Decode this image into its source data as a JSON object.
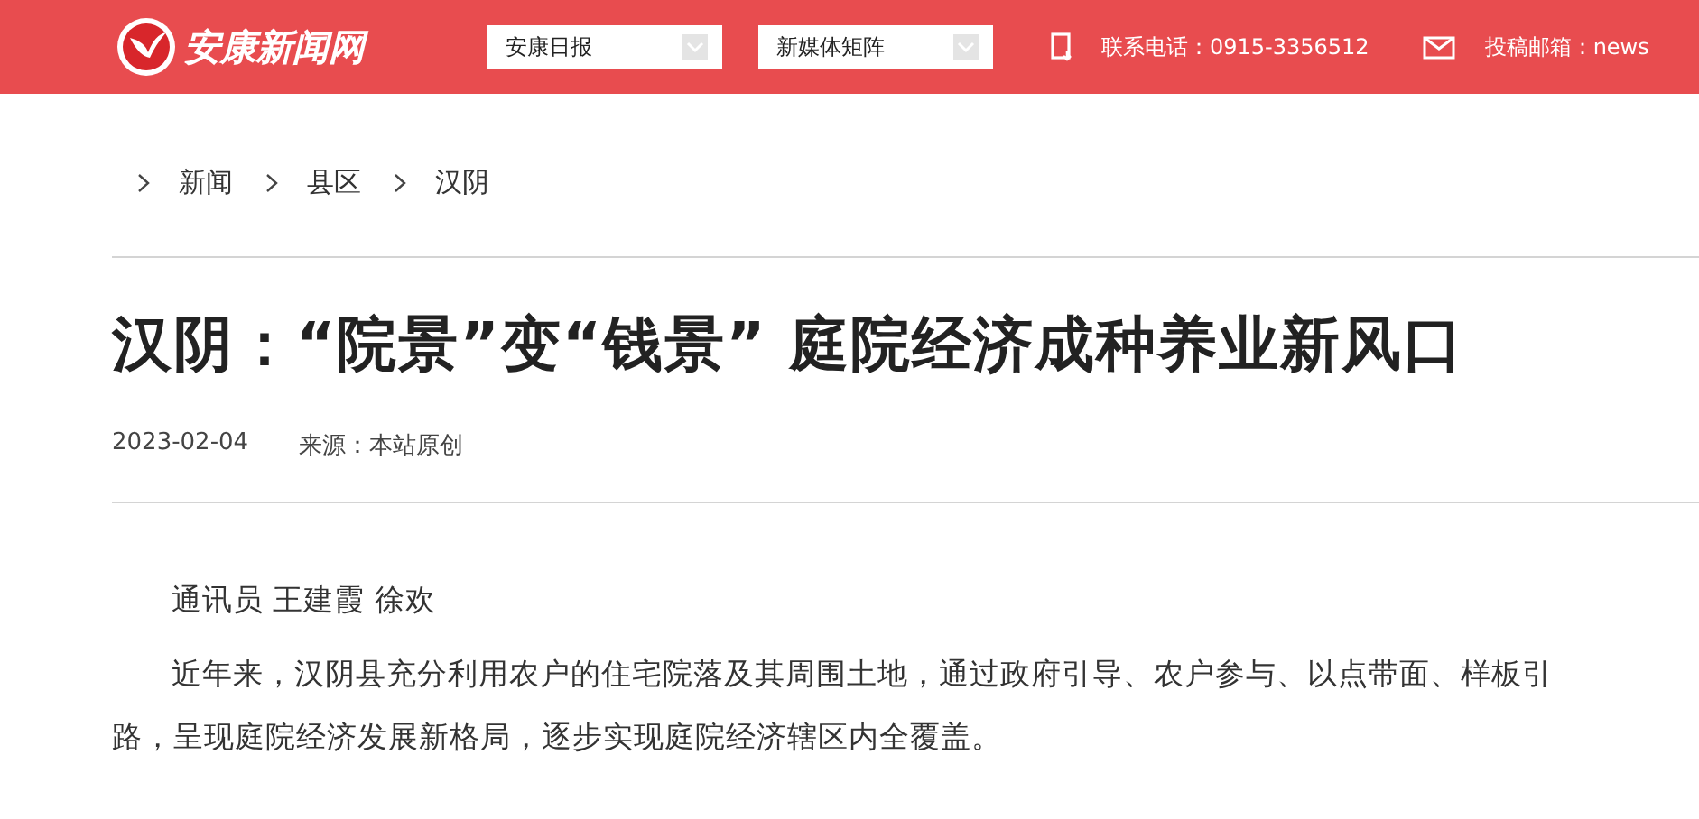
{
  "header": {
    "logo_text": "安康新闻网",
    "selects": [
      {
        "value": "安康日报"
      },
      {
        "value": "新媒体矩阵"
      }
    ],
    "phone": "联系电话：0915-3356512",
    "email": "投稿邮箱：news"
  },
  "breadcrumb": [
    "新闻",
    "县区",
    "汉阴"
  ],
  "article": {
    "title": "汉阴：“院景”变“钱景” 庭院经济成种养业新风口",
    "date": "2023-02-04",
    "source": "来源：本站原创",
    "paragraphs": [
      "通讯员 王建霞 徐欢",
      "近年来，汉阴县充分利用农户的住宅院落及其周围土地，通过政府引导、农户参与、以点带面、样板引路，呈现庭院经济发展新格局，逐步实现庭院经济辖区内全覆盖。"
    ]
  }
}
